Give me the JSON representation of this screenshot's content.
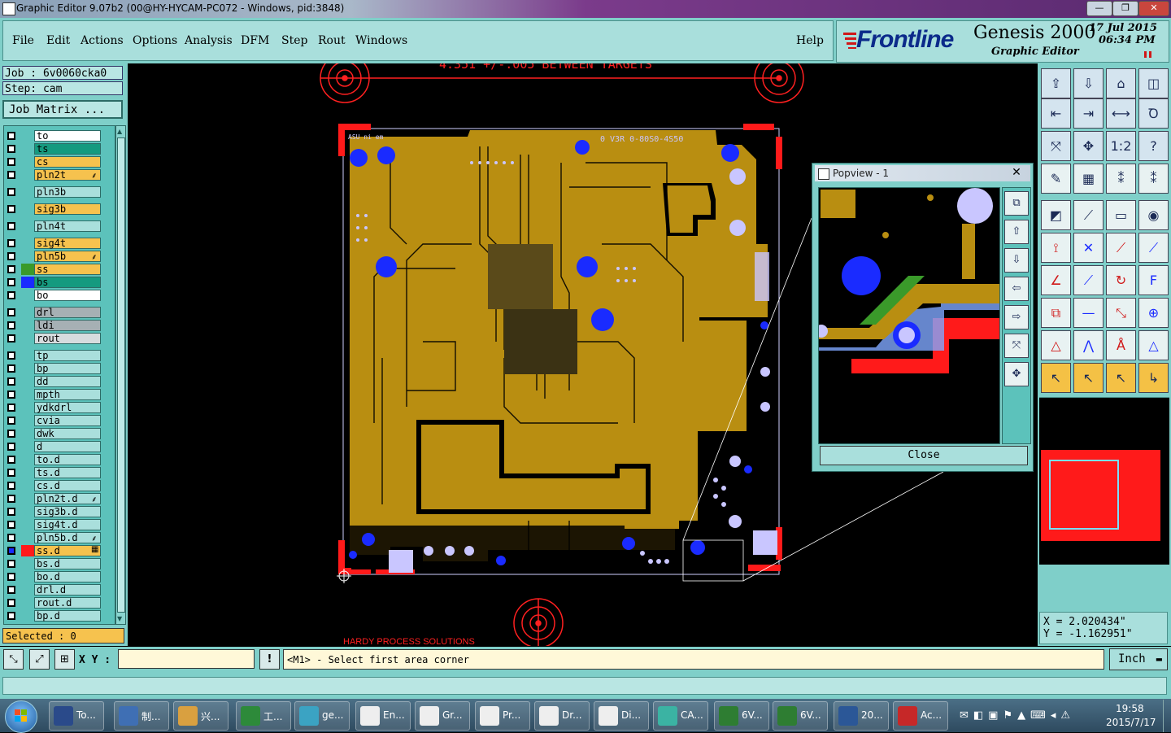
{
  "window": {
    "title": "Graphic Editor 9.07b2 (00@HY-HYCAM-PC072 - Windows, pid:3848)",
    "controls": [
      "—",
      "❐",
      "✕"
    ]
  },
  "menu": [
    "File",
    "Edit",
    "Actions",
    "Options",
    "Analysis",
    "DFM",
    "Step",
    "Rout",
    "Windows"
  ],
  "help": "Help",
  "brand": {
    "logo": "Frontline",
    "product": "Genesis 2000",
    "subtitle": "Graphic Editor",
    "date": "17  Jul  2015",
    "time": "06:34  PM"
  },
  "job": {
    "job_line": "Job : 6v0060cka0",
    "step_line": "Step: cam",
    "matrix_button": "Job Matrix ..."
  },
  "layers": [
    {
      "name": "to",
      "bg": "#ffffff",
      "swatch": ""
    },
    {
      "name": "ts",
      "bg": "#159a7f",
      "swatch": ""
    },
    {
      "name": "cs",
      "bg": "#f6c24e",
      "swatch": ""
    },
    {
      "name": "pln2t",
      "bg": "#f6c24e",
      "swatch": "",
      "mark": "⸙"
    },
    {
      "name": "pln3b",
      "bg": "#a9dfdc",
      "swatch": ""
    },
    {
      "name": "sig3b",
      "bg": "#f6c24e",
      "swatch": ""
    },
    {
      "name": "pln4t",
      "bg": "#a9dfdc",
      "swatch": ""
    },
    {
      "name": "sig4t",
      "bg": "#f6c24e",
      "swatch": ""
    },
    {
      "name": "pln5b",
      "bg": "#f6c24e",
      "swatch": "",
      "mark": "⸙"
    },
    {
      "name": "ss",
      "bg": "#f6c24e",
      "swatch": "#3a9a2a"
    },
    {
      "name": "bs",
      "bg": "#159a7f",
      "swatch": "#1a2bff"
    },
    {
      "name": "bo",
      "bg": "#ffffff",
      "swatch": ""
    },
    {
      "name": "drl",
      "bg": "#a6b0b4",
      "swatch": ""
    },
    {
      "name": "ldi",
      "bg": "#a6b0b4",
      "swatch": ""
    },
    {
      "name": "rout",
      "bg": "#d7dcde",
      "swatch": ""
    },
    {
      "name": "tp",
      "bg": "#a9dfdc",
      "swatch": ""
    },
    {
      "name": "bp",
      "bg": "#a9dfdc",
      "swatch": ""
    },
    {
      "name": "dd",
      "bg": "#a9dfdc",
      "swatch": ""
    },
    {
      "name": "mpth",
      "bg": "#a9dfdc",
      "swatch": ""
    },
    {
      "name": "ydkdrl",
      "bg": "#a9dfdc",
      "swatch": ""
    },
    {
      "name": "cvia",
      "bg": "#a9dfdc",
      "swatch": ""
    },
    {
      "name": "dwk",
      "bg": "#a9dfdc",
      "swatch": ""
    },
    {
      "name": "d",
      "bg": "#a9dfdc",
      "swatch": ""
    },
    {
      "name": "to.d",
      "bg": "#a9dfdc",
      "swatch": ""
    },
    {
      "name": "ts.d",
      "bg": "#a9dfdc",
      "swatch": ""
    },
    {
      "name": "cs.d",
      "bg": "#a9dfdc",
      "swatch": ""
    },
    {
      "name": "pln2t.d",
      "bg": "#a9dfdc",
      "swatch": "",
      "mark": "⸙"
    },
    {
      "name": "sig3b.d",
      "bg": "#a9dfdc",
      "swatch": ""
    },
    {
      "name": "sig4t.d",
      "bg": "#a9dfdc",
      "swatch": ""
    },
    {
      "name": "pln5b.d",
      "bg": "#a9dfdc",
      "swatch": "",
      "mark": "⸙"
    },
    {
      "name": "ss.d",
      "bg": "#f6c24e",
      "swatch": "#ff1a1a",
      "mark": "▦"
    },
    {
      "name": "bs.d",
      "bg": "#a9dfdc",
      "swatch": ""
    },
    {
      "name": "bo.d",
      "bg": "#a9dfdc",
      "swatch": ""
    },
    {
      "name": "drl.d",
      "bg": "#a9dfdc",
      "swatch": ""
    },
    {
      "name": "rout.d",
      "bg": "#a9dfdc",
      "swatch": ""
    },
    {
      "name": "bp.d",
      "bg": "#a9dfdc",
      "swatch": ""
    }
  ],
  "selected": "Selected : 0",
  "canvas": {
    "top_text": "4.351 +/-.005 BETWEEN TARGETS",
    "board_text_left": "ASU ni em",
    "board_text_right": "0 V3R 0-80S0-4S50",
    "footer_text": "HARDY PROCESS SOLUTIONS"
  },
  "popview": {
    "title": "Popview - 1",
    "close_label": "Close"
  },
  "toolbox_icons": [
    "zoom-home-icon",
    "zoom-fit-icon",
    "home-icon",
    "split-view-icon",
    "pan-left-icon",
    "pan-right-icon",
    "mirror-icon",
    "snake-icon",
    "fit-screen-icon",
    "zoom-center-icon",
    "scale-1-2-icon",
    "help-icon",
    "measure-icon",
    "grid-icon",
    "layers-compare-icon",
    "layers-select-icon",
    "add-pad-icon",
    "draw-line-icon",
    "ruler-icon",
    "circle-pad-icon",
    "connect-icon",
    "delete-node-icon",
    "arc-icon",
    "move-node-icon",
    "angle-icon",
    "slash-icon",
    "undo-arc-icon",
    "text-edit-icon",
    "copy-icon",
    "line-icon",
    "resize-icon",
    "transform-icon",
    "triangle-icon",
    "triangle-up-icon",
    "triangle-a-icon",
    "triangle-b-icon",
    "select-arrow-icon",
    "select-box-icon",
    "select-radius-icon",
    "select-path-icon"
  ],
  "coords": {
    "x": "X = 2.020434\"",
    "y": "Y = -1.162951\""
  },
  "command": {
    "xy_label": "X Y :",
    "input_value": "",
    "prompt": "<M1> - Select first area corner",
    "unit": "Inch"
  },
  "taskbar": {
    "tasks": [
      "To...",
      "制...",
      "兴...",
      "工...",
      "ge...",
      "En...",
      "Gr...",
      "Pr...",
      "Dr...",
      "Di...",
      "CA...",
      "6V...",
      "6V...",
      "20...",
      "Ac..."
    ],
    "time": "19:58",
    "date": "2015/7/17"
  },
  "colors": {
    "teal": "#7fcfc9",
    "board": "#b98e11",
    "pad_blue": "#1a2bff",
    "pad_lavender": "#c9c6ff",
    "mask_red": "#ff1a1a"
  }
}
